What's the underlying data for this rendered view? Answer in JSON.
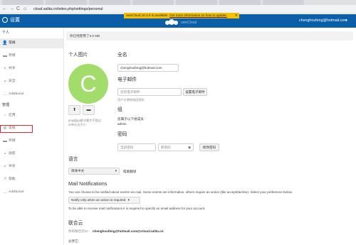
{
  "browser": {
    "url": "cloud.salita.cn/index.php/settings/personal",
    "nav_back": "←",
    "nav_forward": "→",
    "nav_reload": "C",
    "nav_home": "⌂"
  },
  "header": {
    "app_title": "设置",
    "brand": "ownCloud",
    "user": "chenghoufeng@hotmail.com",
    "caret": "▾",
    "colors": {
      "header_bg": "#0b5fa8",
      "banner_bg": "#f5c000"
    }
  },
  "update_banner": {
    "text": "ownCloud 10.4.0 is available.",
    "link": "Get more information on how to update.",
    "close": "✕"
  },
  "sidebar": {
    "personal_title": "个人",
    "personal_items": [
      {
        "label": "常规",
        "icon": "person-icon",
        "glyph": "👤",
        "active": true
      },
      {
        "label": "存储",
        "icon": "folder-icon",
        "glyph": "▬",
        "active": false
      },
      {
        "label": "共享",
        "icon": "share-icon",
        "glyph": "<",
        "active": false
      },
      {
        "label": "安全",
        "icon": "lock-icon",
        "glyph": "▪",
        "active": false
      },
      {
        "label": "Additional",
        "icon": "dots-icon",
        "glyph": "…",
        "active": false
      }
    ],
    "admin_title": "管理",
    "admin_items": [
      {
        "label": "应用",
        "icon": "apps-icon",
        "glyph": "▫",
        "active": false
      },
      {
        "label": "常规",
        "icon": "gear-icon",
        "glyph": "⚙",
        "active": false
      },
      {
        "label": "存储",
        "icon": "folder-icon",
        "glyph": "▬",
        "active": false
      },
      {
        "label": "加密",
        "icon": "lock-icon",
        "glyph": "▪",
        "active": false
      },
      {
        "label": "共享",
        "icon": "share-icon",
        "glyph": "<",
        "active": false
      },
      {
        "label": "帮助",
        "icon": "help-icon",
        "glyph": "?",
        "active": false
      },
      {
        "label": "Additional",
        "icon": "dots-icon",
        "glyph": "…",
        "active": false
      }
    ],
    "highlight_color": "#e0292e"
  },
  "main": {
    "quota_text": "你已经使用了5.5 MB",
    "profile_picture": {
      "title": "个人图片",
      "avatar_letter": "C",
      "avatar_color": "#a2dd6b",
      "upload_glyph": "⬆",
      "folder_glyph": "▬",
      "hint_line1": "png或jpg格式最大不超过",
      "hint_line2": "20M左右大小"
    },
    "full_name": {
      "title": "全名",
      "value": "chenghoufeng@hotmail.com"
    },
    "email": {
      "title": "电子邮件",
      "placeholder": "您的电子邮件",
      "button": "设置电子邮件",
      "hint": "用户方便和找回密码"
    },
    "group": {
      "title": "组",
      "line": "您属于以下组成员:",
      "value": "admin"
    },
    "password": {
      "title": "密码",
      "current_placeholder": "当前密码",
      "new_placeholder": "新密码",
      "eye_glyph": "◉",
      "button": "修改密码"
    },
    "language": {
      "title": "语言",
      "value": "简体中文",
      "caret": "▾",
      "help": "帮助翻译"
    },
    "mail_notifications": {
      "title": "Mail Notifications",
      "description": "You can choose to be notified about events via mail. Some events are informative, others require an action (like accept/decline). Select your preference below:",
      "select_value": "Notify only when an action is required",
      "select_caret": "▾",
      "note": "To be able to receive mail notifications it is required to specify an email address for your account."
    },
    "federated_cloud": {
      "title": "联合云",
      "id_label": "你的联合云ID:",
      "id_value": "chenghoufeng@hotmail.com@cloud.salita.cn",
      "share_label": "分享它:"
    }
  }
}
